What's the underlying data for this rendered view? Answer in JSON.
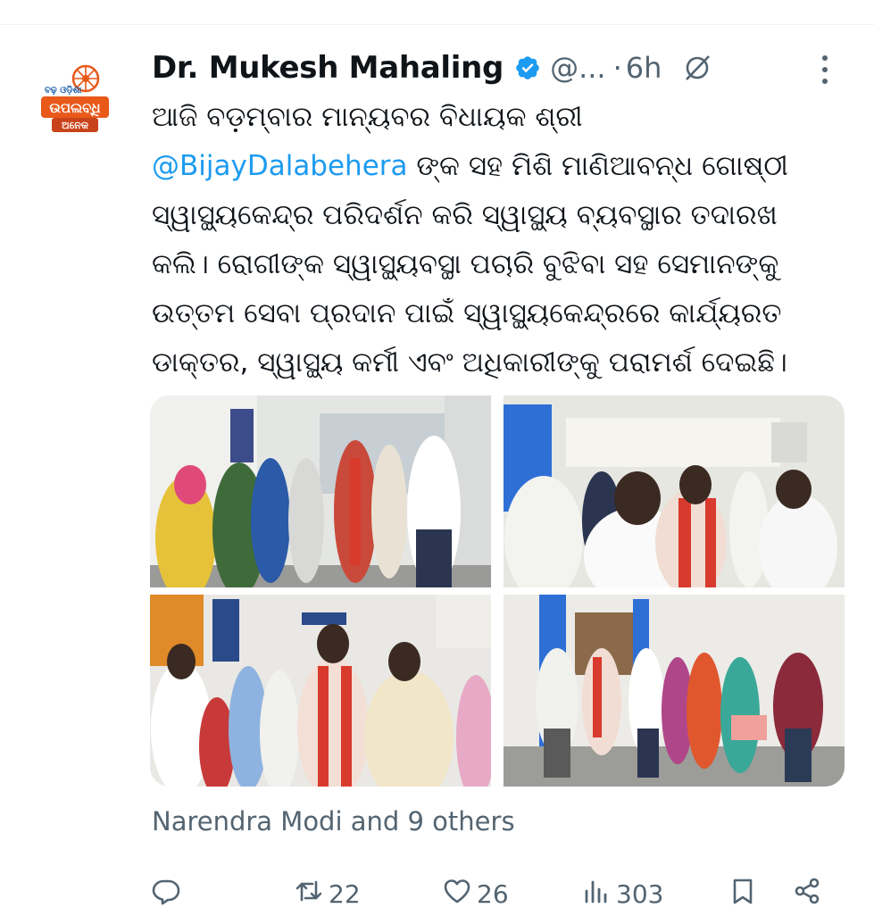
{
  "tweet": {
    "author_name": "Dr. Mukesh Mahaling",
    "handle": "@...",
    "dot": "·",
    "time": "6h",
    "text_line1": "ଆଜି ବଡ଼ମ୍ବାର ମାନ୍ୟବର ବିଧାୟକ ଶ୍ରୀ",
    "mention": "@BijayDalabehera",
    "text_line2_rest": " ଙ୍କ ସହ ମିଶି ମାଣିଆବନ୍ଧ ଗୋଷ୍ଠୀ",
    "text_rest": "ସ୍ୱାସ୍ଥ୍ୟକେନ୍ଦ୍ର ପରିଦର୍ଶନ କରି ସ୍ୱାସ୍ଥ୍ୟ ବ୍ୟବସ୍ଥାର ତଦାରଖ\nକଲି। ରୋଗୀଙ୍କ ସ୍ୱାସ୍ଥ୍ୟବସ୍ଥା ପଚାରି ବୁଝିବା ସହ ସେମାନଙ୍କୁ\nଉତ୍ତମ ସେବା ପ୍ରଦାନ ପାଇଁ ସ୍ୱାସ୍ଥ୍ୟକେନ୍ଦ୍ରରେ କାର୍ଯ୍ୟରତ\nଡାକ୍ତର, ସ୍ୱାସ୍ଥ୍ୟ କର୍ମୀ ଏବଂ ଅଧିକାରୀଙ୍କୁ ପରାମର୍ଶ ଦେଇଛି।",
    "likers": "Narendra Modi and 9 others"
  },
  "avatar": {
    "logo_text": "ବଢ଼ ଓଡ଼ିଶା ଉପଲବ୍ଧି ଅନେକ"
  },
  "actions": {
    "retweets": "22",
    "likes": "26",
    "views": "303"
  },
  "icons": [
    "verified-badge-icon",
    "no-link-icon",
    "more-icon",
    "reply-icon",
    "retweet-icon",
    "like-icon",
    "views-icon",
    "bookmark-icon",
    "share-icon"
  ],
  "colors": {
    "accent": "#1d9bf0",
    "secondary_text": "#536471",
    "text": "#0f1419",
    "logo_orange": "#e8591a"
  }
}
